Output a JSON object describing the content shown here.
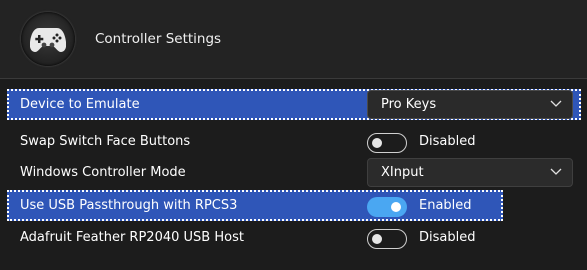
{
  "header": {
    "title": "Controller Settings",
    "icon": "gamepad-icon"
  },
  "settings": [
    {
      "label": "Device to Emulate",
      "type": "dropdown",
      "value": "Pro Keys",
      "focused": true
    },
    {
      "label": "Swap Switch Face Buttons",
      "type": "toggle",
      "value": "Disabled",
      "on": false
    },
    {
      "label": "Windows Controller Mode",
      "type": "dropdown",
      "value": "XInput"
    },
    {
      "label": "Use USB Passthrough with RPCS3",
      "type": "toggle",
      "value": "Enabled",
      "on": true,
      "focused": true
    },
    {
      "label": "Adafruit Feather RP2040 USB Host",
      "type": "toggle",
      "value": "Disabled",
      "on": false
    }
  ],
  "colors": {
    "background": "#1c1c1c",
    "header": "#232323",
    "focus_row": "#2f56b8",
    "toggle_on": "#4aa7f2"
  }
}
